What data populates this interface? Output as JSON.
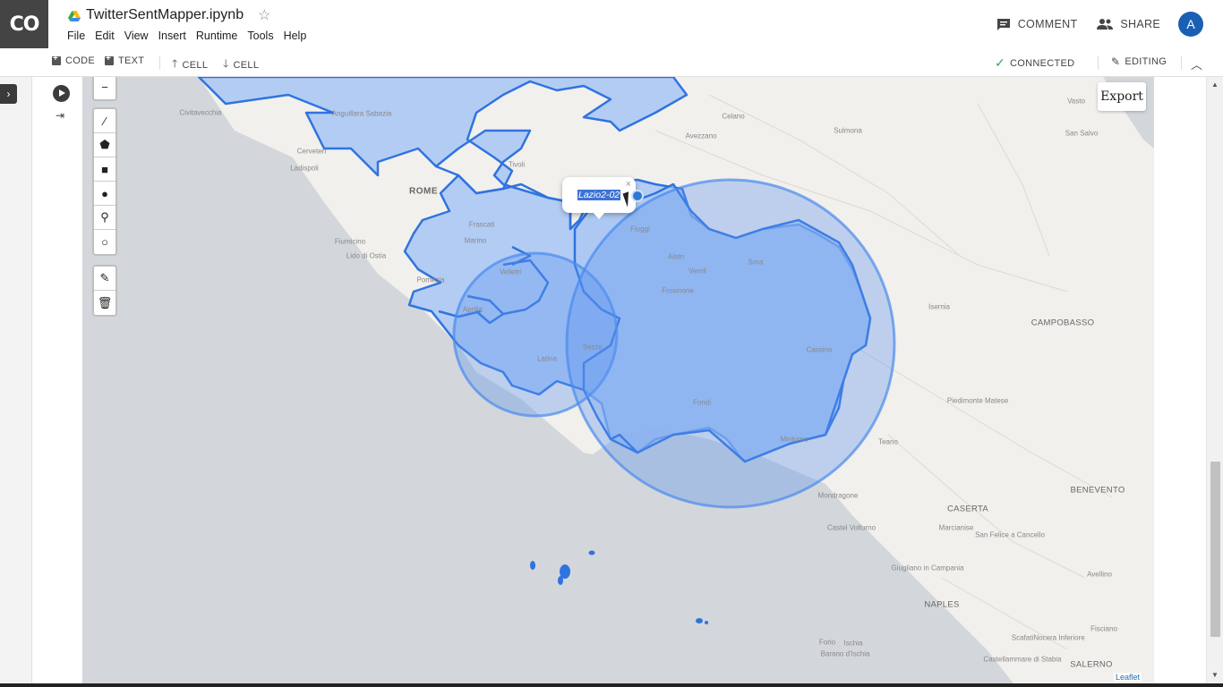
{
  "app": {
    "logo": "CO",
    "title": "TwitterSentMapper.ipynb"
  },
  "menu": [
    "File",
    "Edit",
    "View",
    "Insert",
    "Runtime",
    "Tools",
    "Help"
  ],
  "header_actions": {
    "comment": "COMMENT",
    "share": "SHARE",
    "avatar": "A"
  },
  "toolbar": {
    "code": "CODE",
    "text": "TEXT",
    "cell_up": "CELL",
    "cell_down": "CELL",
    "connected": "CONNECTED",
    "editing": "EDITING"
  },
  "map": {
    "export_label": "Export",
    "attribution": "Leaflet",
    "popup_label": "Lazio2-02",
    "colors": {
      "region": "#a8c6f4",
      "stroke": "#2f73e0",
      "circle_fill": "#5b93ee",
      "sea": "#d3d7db",
      "land": "#f2f0ec"
    },
    "labels": [
      {
        "text": "Civitavecchia",
        "kind": "small"
      },
      {
        "text": "Cerveteri",
        "kind": "small"
      },
      {
        "text": "Ladispoli",
        "kind": "small"
      },
      {
        "text": "Anguillara Sabazia",
        "kind": "small"
      },
      {
        "text": "ROME",
        "kind": "big"
      },
      {
        "text": "Tivoli",
        "kind": "small"
      },
      {
        "text": "Frascati",
        "kind": "small"
      },
      {
        "text": "Marino",
        "kind": "small"
      },
      {
        "text": "Fiumicino",
        "kind": "small"
      },
      {
        "text": "Lido di Ostia",
        "kind": "small"
      },
      {
        "text": "Pomezia",
        "kind": "small"
      },
      {
        "text": "Velletri",
        "kind": "small"
      },
      {
        "text": "Aprilia",
        "kind": "small"
      },
      {
        "text": "Latina",
        "kind": "small"
      },
      {
        "text": "Sezze",
        "kind": "small"
      },
      {
        "text": "Fiuggi",
        "kind": "small"
      },
      {
        "text": "Alatri",
        "kind": "small"
      },
      {
        "text": "Veroli",
        "kind": "small"
      },
      {
        "text": "Frosinone",
        "kind": "small"
      },
      {
        "text": "Sora",
        "kind": "small"
      },
      {
        "text": "Cassino",
        "kind": "small"
      },
      {
        "text": "Fondi",
        "kind": "small"
      },
      {
        "text": "Minturno",
        "kind": "small"
      },
      {
        "text": "Celano",
        "kind": "small"
      },
      {
        "text": "Avezzano",
        "kind": "small"
      },
      {
        "text": "Sulmona",
        "kind": "small"
      },
      {
        "text": "Vasto",
        "kind": "small"
      },
      {
        "text": "San Salvo",
        "kind": "small"
      },
      {
        "text": "Isernia",
        "kind": "small"
      },
      {
        "text": "CAMPOBASSO",
        "kind": "med"
      },
      {
        "text": "Piedimonte Matese",
        "kind": "small"
      },
      {
        "text": "Teano",
        "kind": "small"
      },
      {
        "text": "Mondragone",
        "kind": "small"
      },
      {
        "text": "Castel Volturno",
        "kind": "small"
      },
      {
        "text": "BENEVENTO",
        "kind": "med"
      },
      {
        "text": "CASERTA",
        "kind": "med"
      },
      {
        "text": "Marcianise",
        "kind": "small"
      },
      {
        "text": "San Felice a Cancello",
        "kind": "small"
      },
      {
        "text": "Giugliano in Campania",
        "kind": "small"
      },
      {
        "text": "Avellino",
        "kind": "small"
      },
      {
        "text": "NAPLES",
        "kind": "med"
      },
      {
        "text": "Scafati",
        "kind": "small"
      },
      {
        "text": "Nocera Inferiore",
        "kind": "small"
      },
      {
        "text": "Fisciano",
        "kind": "small"
      },
      {
        "text": "Forio",
        "kind": "small"
      },
      {
        "text": "Ischia",
        "kind": "small"
      },
      {
        "text": "Barano d'Ischia",
        "kind": "small"
      },
      {
        "text": "Castellammare di Stabia",
        "kind": "small"
      },
      {
        "text": "SALERNO",
        "kind": "med"
      }
    ]
  }
}
